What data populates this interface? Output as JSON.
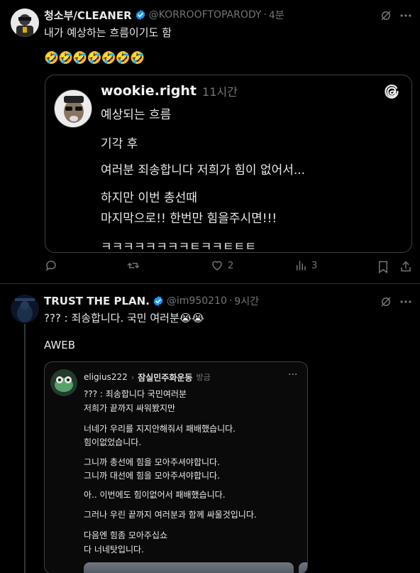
{
  "post1": {
    "author_name": "청소부/CLEANER",
    "handle": "@KORROOFTOPARODY",
    "separator": "·",
    "time": "4분",
    "text_line1": "내가 예상하는 흐름이기도 함",
    "emoji_line": "🤣🤣🤣🤣🤣🤣🤣",
    "quote": {
      "author": "wookie.right",
      "time": "11시간",
      "lines": [
        "예상되는 흐름",
        "기각 후",
        "여러분 죄송합니다 저희가 힘이 없어서...",
        "하지만 이번 총선때",
        "마지막으로!! 한번만 힘을주시면!!!",
        "ㅋㅋㅋㅋㅋㅋㅋㅋㅌㅋㅋㅌㅌㅌ"
      ],
      "logo_icon": "threads-logo-icon"
    },
    "actions": {
      "reply_count": "",
      "repost_count": "",
      "like_count": "2",
      "views_count": "3"
    }
  },
  "post2": {
    "author_name": "TRUST THE PLAN.",
    "handle": "@im950210",
    "separator": "·",
    "time": "9시간",
    "text_line1": "??? : 죄송합니다. 국민 여러분😭😭",
    "text_line2": "AWEB",
    "quote": {
      "author": "eligius222",
      "community": "잠실민주화운동",
      "time": "방금",
      "more": "···",
      "lines": [
        "??? : 죄송합니다 국민여러분",
        "저희가 끝까지 싸워봤지만",
        "너네가 우리를 지지안해줘서 패배했습니다.",
        "힘이없었습니다.",
        "그니까 총선에 힘을 모아주셔야합니다.",
        "그니까 대선에 힘을 모아주셔야합니다.",
        "아.. 이번에도 힘이없어서 패배했습니다.",
        "그러나 우린 끝까지 여러분과 함께 싸울것입니다.",
        "다음엔 힘좀 모아주십쇼",
        "다 너네탓입니다."
      ]
    }
  },
  "colors": {
    "background": "#000000",
    "text": "#e7e9ea",
    "muted": "#71767b",
    "verified": "#1d9bf0",
    "border": "#2f3336"
  }
}
